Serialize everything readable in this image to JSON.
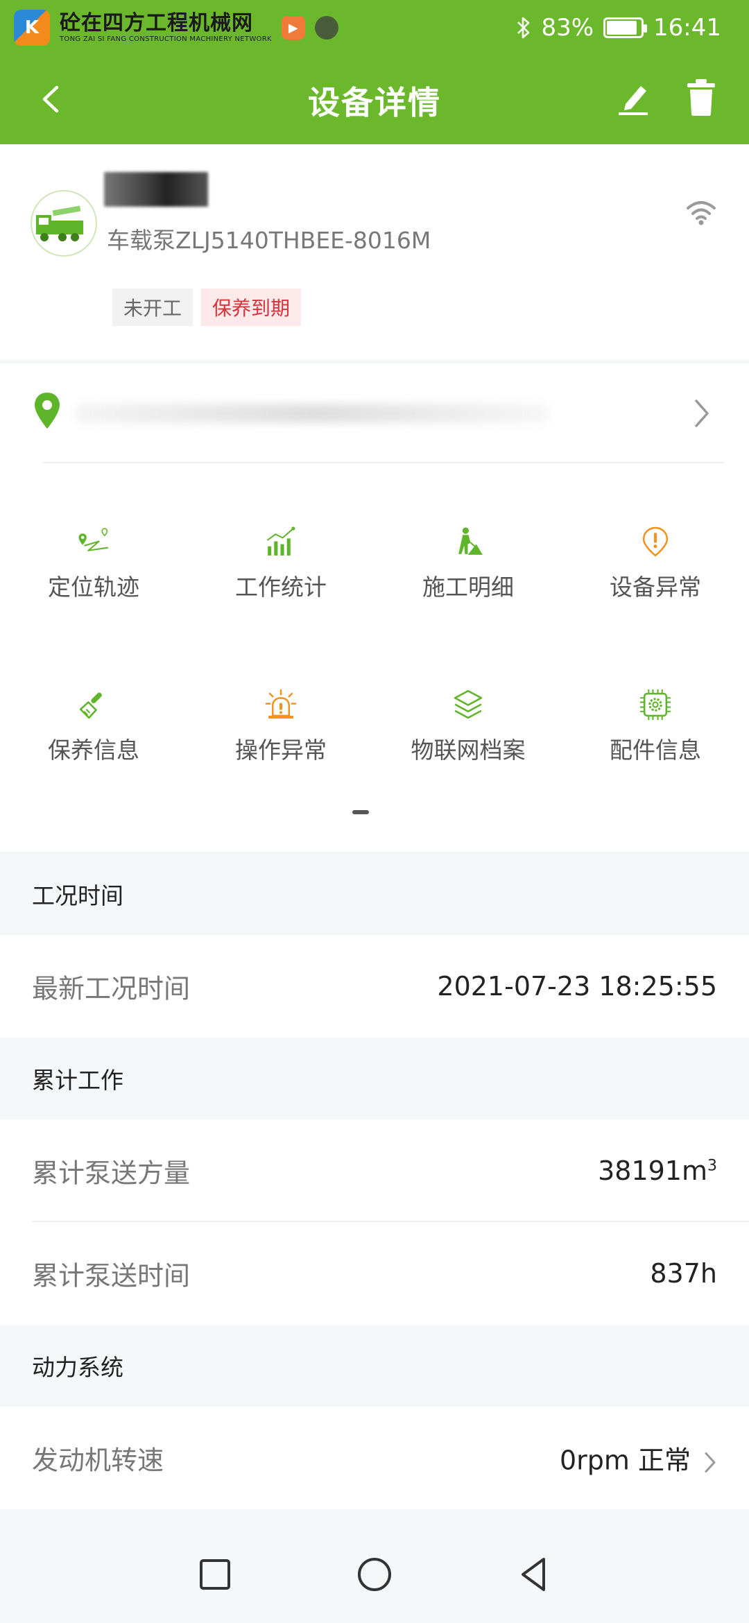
{
  "status_bar": {
    "watermark_logo": "砼在四方工程机械网",
    "watermark_sub": "TONG ZAI SI FANG CONSTRUCTION MACHINERY NETWORK",
    "battery": "83%",
    "time": "16:41",
    "battery_level": 0.83
  },
  "header": {
    "title": "设备详情",
    "back_icon": "chevron-left-icon",
    "edit_icon": "pencil-icon",
    "delete_icon": "trash-icon",
    "color": "#6cb82c"
  },
  "device": {
    "model": "车载泵ZLJ5140THBEE-8016M",
    "tags": [
      "未开工",
      "保养到期"
    ]
  },
  "grid": {
    "items": [
      {
        "label": "定位轨迹",
        "icon": "location-track-icon"
      },
      {
        "label": "工作统计",
        "icon": "statistics-icon"
      },
      {
        "label": "施工明细",
        "icon": "construction-worker-icon"
      },
      {
        "label": "设备异常",
        "icon": "warning-icon"
      },
      {
        "label": "保养信息",
        "icon": "brush-icon"
      },
      {
        "label": "操作异常",
        "icon": "alarm-light-icon"
      },
      {
        "label": "物联网档案",
        "icon": "layers-icon"
      },
      {
        "label": "配件信息",
        "icon": "chip-gear-icon"
      }
    ]
  },
  "sections": {
    "condition": {
      "title": "工况时间",
      "rows": [
        {
          "label": "最新工况时间",
          "value": "2021-07-23 18:25:55"
        }
      ]
    },
    "cumulative": {
      "title": "累计工作",
      "rows": [
        {
          "label": "累计泵送方量",
          "value": "38191m",
          "unit_sup": "3"
        },
        {
          "label": "累计泵送时间",
          "value": "837h"
        }
      ]
    },
    "power": {
      "title": "动力系统",
      "rows": [
        {
          "label": "发动机转速",
          "value": "0rpm 正常"
        }
      ]
    }
  },
  "colors": {
    "accent_green": "#6cb82c",
    "icon_green": "#5fb52a",
    "icon_orange": "#f29320",
    "tag_red": "#d8323a"
  }
}
